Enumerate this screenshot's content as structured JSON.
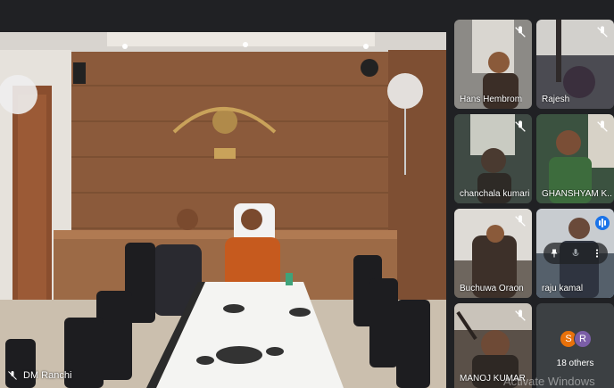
{
  "main_speaker": {
    "name": "DM Ranchi"
  },
  "participants": [
    {
      "name": "Hans Hembrom",
      "muted": true
    },
    {
      "name": "Rajesh",
      "muted": true
    },
    {
      "name": "chanchala kumari",
      "muted": true
    },
    {
      "name": "GHANSHYAM K...",
      "muted": true
    },
    {
      "name": "Buchuwa Oraon",
      "muted": true
    },
    {
      "name": "raju kamal",
      "muted": false,
      "speaking": true
    },
    {
      "name": "MANOJ KUMAR",
      "muted": true
    }
  ],
  "others": {
    "label": "18 others",
    "avatars": [
      {
        "letter": "S",
        "color": "#e8710a"
      },
      {
        "letter": "R",
        "color": "#7b5ea7"
      }
    ]
  },
  "watermark": "Activate Windows",
  "icons": {
    "mute": "mic-off-icon",
    "pin": "pin-icon",
    "mic": "mic-icon",
    "more": "more-vert-icon",
    "speaking": "speaking-icon"
  },
  "colors": {
    "background": "#202124",
    "tile": "#3c4043",
    "active_outline": "#8ab4f8",
    "speaking": "#1a73e8"
  }
}
